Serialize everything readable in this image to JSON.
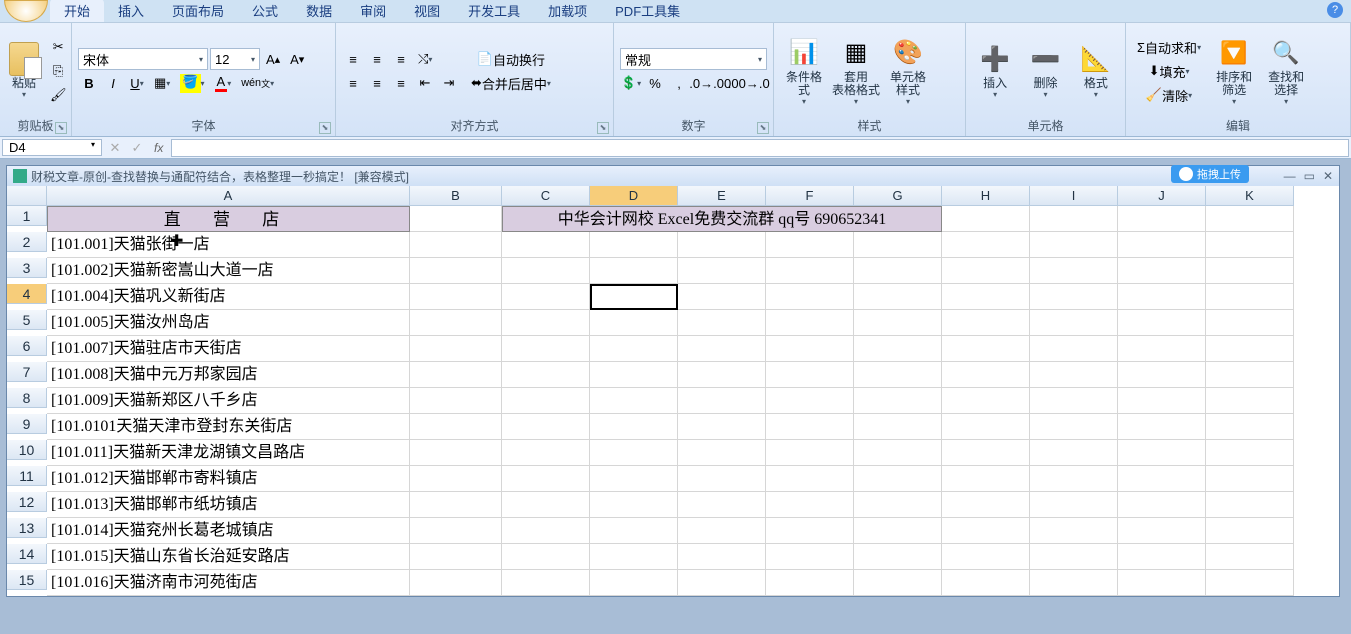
{
  "tabs": [
    "开始",
    "插入",
    "页面布局",
    "公式",
    "数据",
    "审阅",
    "视图",
    "开发工具",
    "加载项",
    "PDF工具集"
  ],
  "active_tab": 0,
  "ribbon": {
    "clipboard": {
      "label": "剪贴板",
      "paste": "粘贴"
    },
    "font": {
      "label": "字体",
      "name": "宋体",
      "size": "12"
    },
    "align": {
      "label": "对齐方式",
      "wrap": "自动换行",
      "merge": "合并后居中"
    },
    "number": {
      "label": "数字",
      "format": "常规"
    },
    "styles": {
      "label": "样式",
      "cond": "条件格式",
      "table": "套用\n表格格式",
      "cell": "单元格\n样式"
    },
    "cells": {
      "label": "单元格",
      "insert": "插入",
      "delete": "删除",
      "format": "格式"
    },
    "editing": {
      "label": "编辑",
      "sum": "自动求和",
      "fill": "填充",
      "clear": "清除",
      "sort": "排序和\n筛选",
      "find": "查找和\n选择"
    }
  },
  "name_box": "D4",
  "doc_title": "财税文章-原创-查找替换与通配符结合，表格整理一秒搞定！  [兼容模式]",
  "upload_badge": "拖拽上传",
  "columns": [
    "A",
    "B",
    "C",
    "D",
    "E",
    "F",
    "G",
    "H",
    "I",
    "J",
    "K"
  ],
  "active_col": "D",
  "active_row": 4,
  "header_A": "直 营 店",
  "merged_header": "中华会计网校 Excel免费交流群 qq号 690652341",
  "rows": [
    "[101.001]天猫张街一店",
    "[101.002]天猫新密嵩山大道一店",
    "[101.004]天猫巩义新街店",
    "[101.005]天猫汝州岛店",
    "[101.007]天猫驻店市天街店",
    "[101.008]天猫中元万邦家园店",
    "[101.009]天猫新郑区八千乡店",
    "[101.0101天猫天津市登封东关街店",
    "[101.011]天猫新天津龙湖镇文昌路店",
    "[101.012]天猫邯郸市寄料镇店",
    "[101.013]天猫邯郸市纸坊镇店",
    "[101.014]天猫兖州长葛老城镇店",
    "[101.015]天猫山东省长治延安路店",
    "[101.016]天猫济南市河苑街店"
  ]
}
